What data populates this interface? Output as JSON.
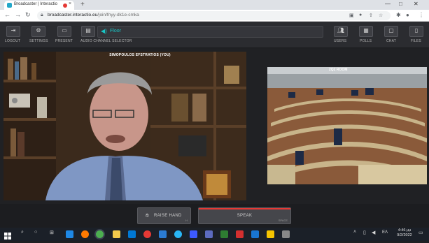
{
  "browser": {
    "tab_title": "Broadcaster | Interactio",
    "tab_close": "×",
    "new_tab": "+",
    "url_host": "broadcaster.interactio.eu",
    "url_path": "/join/fnyy-dk1e-cmka",
    "window_min": "—",
    "window_max": "□",
    "window_close": "✕"
  },
  "toolbar": {
    "logout_label": "LOGOUT",
    "settings_label": "SETTINGS",
    "present_label": "PRESENT",
    "audio_selector_label": "AUDIO CHANNEL SELECTOR",
    "floor_channel": "Floor",
    "users_label": "USERS",
    "polls_label": "POLLS",
    "chat_label": "CHAT",
    "files_label": "FILES"
  },
  "videos": {
    "speaker_name": "SIMOPOULOS EFSTRATIOS (YOU)",
    "room_name": "2Q2 ROOM"
  },
  "controls": {
    "raise_hand_label": "RAISE HAND",
    "raise_hand_shortcut": "H",
    "speak_label": "SPEAK",
    "speak_shortcut": "SPACE"
  },
  "taskbar": {
    "language": "ΕΛ",
    "time": "4:46 μμ",
    "date": "9/2/2022"
  },
  "colors": {
    "accent_teal": "#19c6c6",
    "speak_indicator": "#e53935",
    "toolbar_bg": "#2b2c30"
  }
}
